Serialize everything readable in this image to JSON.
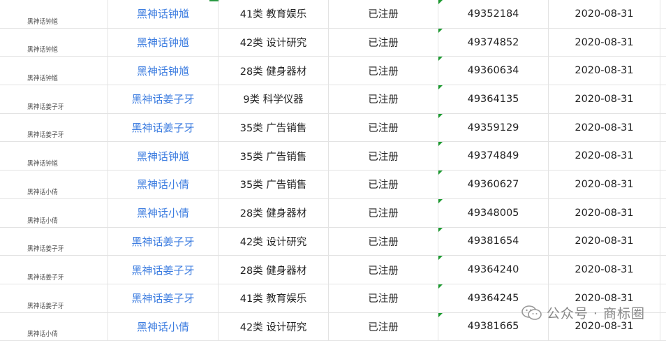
{
  "rows": [
    {
      "thumb": "黑神话钟馗",
      "brand": "黑神话钟馗",
      "klass": "41类 教育娱乐",
      "status": "已注册",
      "reg_no": "49352184",
      "date": "2020-08-31"
    },
    {
      "thumb": "黑神话钟馗",
      "brand": "黑神话钟馗",
      "klass": "42类 设计研究",
      "status": "已注册",
      "reg_no": "49374852",
      "date": "2020-08-31"
    },
    {
      "thumb": "黑神话钟馗",
      "brand": "黑神话钟馗",
      "klass": "28类 健身器材",
      "status": "已注册",
      "reg_no": "49360634",
      "date": "2020-08-31"
    },
    {
      "thumb": "黑神话姜子牙",
      "brand": "黑神话姜子牙",
      "klass": "9类 科学仪器",
      "status": "已注册",
      "reg_no": "49364135",
      "date": "2020-08-31"
    },
    {
      "thumb": "黑神话姜子牙",
      "brand": "黑神话姜子牙",
      "klass": "35类 广告销售",
      "status": "已注册",
      "reg_no": "49359129",
      "date": "2020-08-31"
    },
    {
      "thumb": "黑神话钟馗",
      "brand": "黑神话钟馗",
      "klass": "35类 广告销售",
      "status": "已注册",
      "reg_no": "49374849",
      "date": "2020-08-31"
    },
    {
      "thumb": "黑神话小倩",
      "brand": "黑神话小倩",
      "klass": "35类 广告销售",
      "status": "已注册",
      "reg_no": "49360627",
      "date": "2020-08-31"
    },
    {
      "thumb": "黑神话小倩",
      "brand": "黑神话小倩",
      "klass": "28类 健身器材",
      "status": "已注册",
      "reg_no": "49348005",
      "date": "2020-08-31"
    },
    {
      "thumb": "黑神话姜子牙",
      "brand": "黑神话姜子牙",
      "klass": "42类 设计研究",
      "status": "已注册",
      "reg_no": "49381654",
      "date": "2020-08-31"
    },
    {
      "thumb": "黑神话姜子牙",
      "brand": "黑神话姜子牙",
      "klass": "28类 健身器材",
      "status": "已注册",
      "reg_no": "49364240",
      "date": "2020-08-31"
    },
    {
      "thumb": "黑神话姜子牙",
      "brand": "黑神话姜子牙",
      "klass": "41类 教育娱乐",
      "status": "已注册",
      "reg_no": "49364245",
      "date": "2020-08-31"
    },
    {
      "thumb": "黑神话小倩",
      "brand": "黑神话小倩",
      "klass": "42类 设计研究",
      "status": "已注册",
      "reg_no": "49381665",
      "date": "2020-08-31"
    }
  ],
  "watermark": {
    "text": "公众号 · 商标圈",
    "icon": "wechat-icon"
  },
  "colors": {
    "brand_link": "#3d7de0",
    "grid_line": "#e3e3e3",
    "cell_marker": "#1a9a2e"
  }
}
